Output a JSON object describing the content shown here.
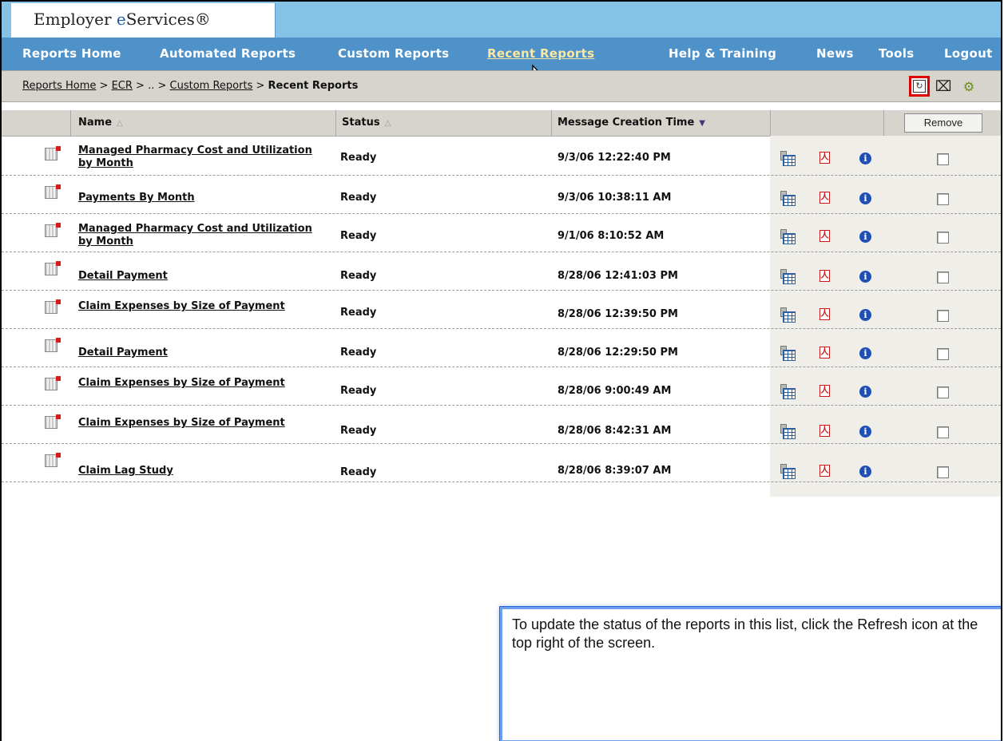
{
  "brand": {
    "prefix": "Employer ",
    "highlight": "e",
    "suffix": "Services®"
  },
  "nav": [
    {
      "label": "Reports Home"
    },
    {
      "label": "Automated Reports"
    },
    {
      "label": "Custom Reports"
    },
    {
      "label": "Recent Reports",
      "active": true
    },
    {
      "label": "Help & Training"
    },
    {
      "label": "News"
    },
    {
      "label": "Tools"
    },
    {
      "label": "Logout"
    }
  ],
  "breadcrumb": {
    "items": [
      "Reports Home",
      "ECR",
      "..",
      "Custom Reports"
    ],
    "separator": ">",
    "current": "Recent Reports"
  },
  "toolbar": {
    "icons": [
      "refresh-icon",
      "clear-icon",
      "gears-icon"
    ]
  },
  "table": {
    "columns": {
      "name": "Name",
      "status": "Status",
      "time": "Message Creation Time"
    },
    "sort_indicators": {
      "name": "△",
      "status": "△",
      "time": "▼"
    },
    "remove_label": "Remove",
    "rows": [
      {
        "name": "Managed Pharmacy Cost and Utilization by Month",
        "status": "Ready",
        "time": "9/3/06 12:22:40 PM"
      },
      {
        "name": "Payments By Month",
        "status": "Ready",
        "time": "9/3/06 10:38:11 AM"
      },
      {
        "name": "Managed Pharmacy Cost and Utilization by Month",
        "status": "Ready",
        "time": "9/1/06 8:10:52 AM"
      },
      {
        "name": "Detail Payment",
        "status": "Ready",
        "time": "8/28/06 12:41:03 PM"
      },
      {
        "name": "Claim Expenses by Size of Payment",
        "status": "Ready",
        "time": "8/28/06 12:39:50 PM"
      },
      {
        "name": "Detail Payment",
        "status": "Ready",
        "time": "8/28/06 12:29:50 PM"
      },
      {
        "name": "Claim Expenses by Size of Payment",
        "status": "Ready",
        "time": "8/28/06 9:00:49 AM"
      },
      {
        "name": "Claim Expenses by Size of Payment",
        "status": "Ready",
        "time": "8/28/06 8:42:31 AM"
      },
      {
        "name": "Claim Lag Study",
        "status": "Ready",
        "time": "8/28/06 8:39:07 AM"
      }
    ]
  },
  "callout": {
    "text": "To update the status of the reports in this list, click the Refresh icon at the top right of the screen."
  },
  "colors": {
    "nav_bg": "#4f92c9",
    "top_bg": "#86c2e6",
    "highlight_border": "#d00000",
    "callout_border": "#6c9ff0"
  }
}
